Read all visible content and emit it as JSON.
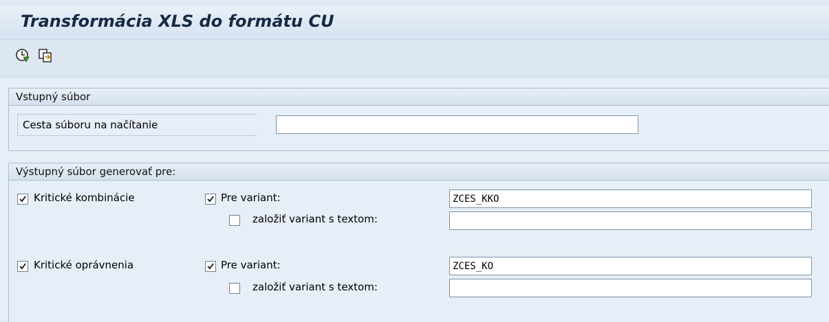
{
  "window": {
    "title": "Transformácia XLS do formátu CU"
  },
  "toolbar": {
    "execute_icon": "execute-icon",
    "variants_icon": "get-variant-icon"
  },
  "input_group": {
    "title": "Vstupný súbor",
    "path_label": "Cesta súboru na načítanie",
    "path_value": ""
  },
  "output_group": {
    "title": "Výstupný súbor generovať pre:",
    "rows": [
      {
        "main_label": "Kritické kombinácie",
        "main_checked": true,
        "variant_label": "Pre variant:",
        "variant_checked": true,
        "variant_value": "ZCES_KKO",
        "create_label": "založiť variant s textom:",
        "create_checked": false,
        "create_value": ""
      },
      {
        "main_label": "Kritické oprávnenia",
        "main_checked": true,
        "variant_label": "Pre variant:",
        "variant_checked": true,
        "variant_value": "ZCES_KO",
        "create_label": "založiť variant s textom:",
        "create_checked": false,
        "create_value": ""
      }
    ]
  }
}
